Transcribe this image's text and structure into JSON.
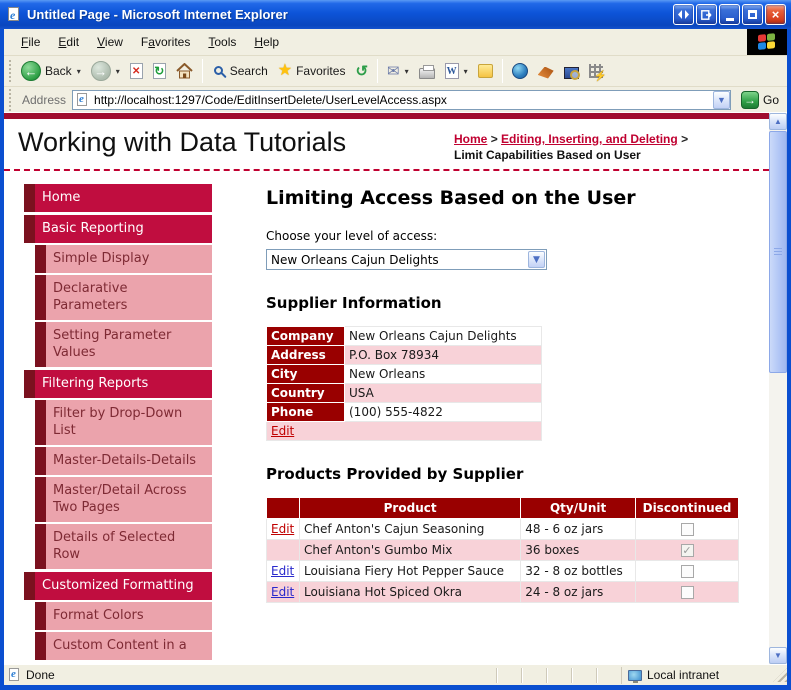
{
  "window": {
    "title": "Untitled Page - Microsoft Internet Explorer",
    "status": "Done",
    "zone": "Local intranet"
  },
  "menu": {
    "items": [
      {
        "label": "File",
        "accel": 0
      },
      {
        "label": "Edit",
        "accel": 0
      },
      {
        "label": "View",
        "accel": 0
      },
      {
        "label": "Favorites",
        "accel": 1
      },
      {
        "label": "Tools",
        "accel": 0
      },
      {
        "label": "Help",
        "accel": 0
      }
    ]
  },
  "toolbar": {
    "back_label": "Back",
    "search_label": "Search",
    "favorites_label": "Favorites"
  },
  "address": {
    "label": "Address",
    "url": "http://localhost:1297/Code/EditInsertDelete/UserLevelAccess.aspx",
    "go_label": "Go"
  },
  "icons": {
    "back_arrow": "←",
    "forward_arrow": "→",
    "stop_x": "✕",
    "refresh": "↻",
    "home": "⌂",
    "star": "★",
    "history": "↺",
    "mail": "✉",
    "caret": "▾",
    "drop_arrow": "▼",
    "go_arrow": "→",
    "scroll_up": "▲",
    "scroll_down": "▼",
    "close": "×",
    "check": "✓",
    "word": "W",
    "arrows_pair": "◂▸"
  },
  "page": {
    "site_title": "Working with Data Tutorials",
    "breadcrumb": {
      "home": "Home",
      "section": "Editing, Inserting, and Deleting",
      "current": "Limit Capabilities Based on User",
      "separator": ">"
    },
    "sidebar": {
      "items": [
        {
          "label": "Home"
        },
        {
          "label": "Basic Reporting"
        },
        {
          "label": "Simple Display"
        },
        {
          "label": "Declarative Parameters"
        },
        {
          "label": "Setting Parameter Values"
        },
        {
          "label": "Filtering Reports"
        },
        {
          "label": "Filter by Drop-Down List"
        },
        {
          "label": "Master-Details-Details"
        },
        {
          "label": "Master/Detail Across Two Pages"
        },
        {
          "label": "Details of Selected Row"
        },
        {
          "label": "Customized Formatting"
        },
        {
          "label": "Format Colors"
        },
        {
          "label": "Custom Content in a"
        }
      ]
    },
    "main": {
      "heading": "Limiting Access Based on the User",
      "access_label": "Choose your level of access:",
      "access_value": "New Orleans Cajun Delights",
      "supplier": {
        "heading": "Supplier Information",
        "rows": [
          {
            "label": "Company",
            "value": "New Orleans Cajun Delights"
          },
          {
            "label": "Address",
            "value": "P.O. Box 78934"
          },
          {
            "label": "City",
            "value": "New Orleans"
          },
          {
            "label": "Country",
            "value": "USA"
          },
          {
            "label": "Phone",
            "value": "(100) 555-4822"
          }
        ],
        "edit_label": "Edit"
      },
      "products": {
        "heading": "Products Provided by Supplier",
        "columns": {
          "edit": "",
          "product": "Product",
          "qty": "Qty/Unit",
          "discontinued": "Discontinued"
        },
        "rows": [
          {
            "edit": "Edit",
            "edit_style": "red",
            "product": "Chef Anton's Cajun Seasoning",
            "qty": "48 - 6 oz jars",
            "discontinued": false
          },
          {
            "edit": "",
            "edit_style": "",
            "product": "Chef Anton's Gumbo Mix",
            "qty": "36 boxes",
            "discontinued": true
          },
          {
            "edit": "Edit",
            "edit_style": "blue",
            "product": "Louisiana Fiery Hot Pepper Sauce",
            "qty": "32 - 8 oz bottles",
            "discontinued": false
          },
          {
            "edit": "Edit",
            "edit_style": "blue",
            "product": "Louisiana Hot Spiced Okra",
            "qty": "24 - 8 oz jars",
            "discontinued": false
          }
        ]
      }
    }
  },
  "colors": {
    "accent_crimson": "#c00d3f",
    "nav_dark": "#7b111f",
    "nav_sub_bg": "#eba3ac",
    "table_header_red": "#990000",
    "row_pink": "#f8d2d8",
    "link_red": "#c00000",
    "link_blue": "#2929cc",
    "breadcrumb_red": "#c00030"
  }
}
